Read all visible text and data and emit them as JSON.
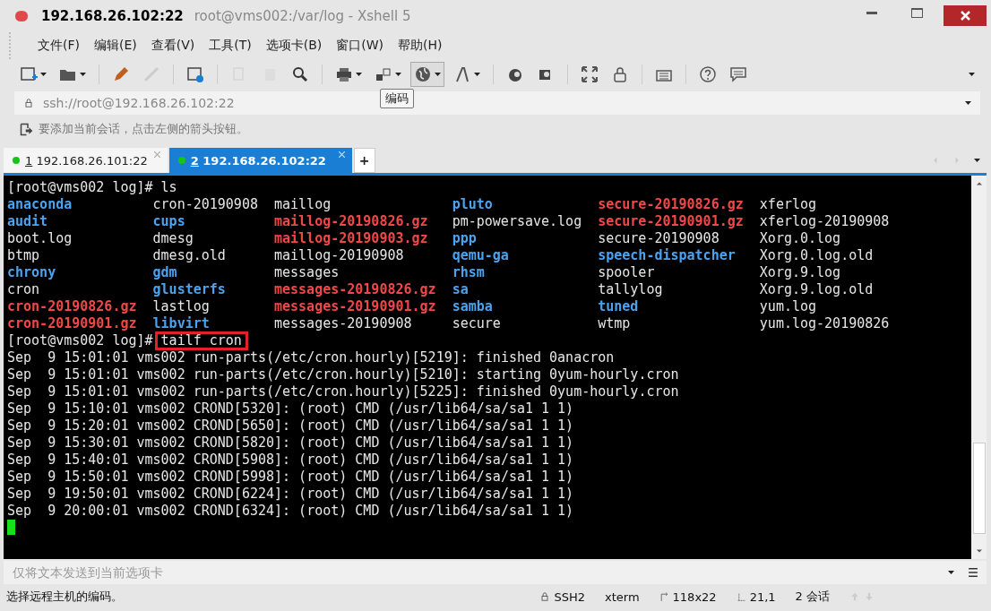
{
  "window": {
    "title": "192.168.26.102:22",
    "subtitle": "root@vms002:/var/log - Xshell 5"
  },
  "menu": [
    "文件(F)",
    "编辑(E)",
    "查看(V)",
    "工具(T)",
    "选项卡(B)",
    "窗口(W)",
    "帮助(H)"
  ],
  "tooltip": "编码",
  "address_bar": {
    "value": "ssh://root@192.168.26.102:22"
  },
  "hint_bar": "要添加当前会话，点击左侧的箭头按钮。",
  "tabs": [
    {
      "number": "1",
      "label": "192.168.26.101:22",
      "selected": false
    },
    {
      "number": "2",
      "label": "192.168.26.102:22",
      "selected": true
    }
  ],
  "new_tab": "+",
  "terminal": {
    "ls_prompt": "[root@vms002 log]# ls",
    "ls_rows": [
      [
        {
          "text": "anaconda",
          "kind": "dir"
        },
        {
          "text": "cron-20190908",
          "kind": "file"
        },
        {
          "text": "maillog",
          "kind": "file"
        },
        {
          "text": "pluto",
          "kind": "dir"
        },
        {
          "text": "secure-20190826.gz",
          "kind": "archive"
        },
        {
          "text": "xferlog",
          "kind": "file"
        }
      ],
      [
        {
          "text": "audit",
          "kind": "dir"
        },
        {
          "text": "cups",
          "kind": "dir"
        },
        {
          "text": "maillog-20190826.gz",
          "kind": "archive"
        },
        {
          "text": "pm-powersave.log",
          "kind": "file"
        },
        {
          "text": "secure-20190901.gz",
          "kind": "archive"
        },
        {
          "text": "xferlog-20190908",
          "kind": "file"
        }
      ],
      [
        {
          "text": "boot.log",
          "kind": "file"
        },
        {
          "text": "dmesg",
          "kind": "file"
        },
        {
          "text": "maillog-20190903.gz",
          "kind": "archive"
        },
        {
          "text": "ppp",
          "kind": "dir"
        },
        {
          "text": "secure-20190908",
          "kind": "file"
        },
        {
          "text": "Xorg.0.log",
          "kind": "file"
        }
      ],
      [
        {
          "text": "btmp",
          "kind": "file"
        },
        {
          "text": "dmesg.old",
          "kind": "file"
        },
        {
          "text": "maillog-20190908",
          "kind": "file"
        },
        {
          "text": "qemu-ga",
          "kind": "dir"
        },
        {
          "text": "speech-dispatcher",
          "kind": "dir"
        },
        {
          "text": "Xorg.0.log.old",
          "kind": "file"
        }
      ],
      [
        {
          "text": "chrony",
          "kind": "dir"
        },
        {
          "text": "gdm",
          "kind": "dir"
        },
        {
          "text": "messages",
          "kind": "file"
        },
        {
          "text": "rhsm",
          "kind": "dir"
        },
        {
          "text": "spooler",
          "kind": "file"
        },
        {
          "text": "Xorg.9.log",
          "kind": "file"
        }
      ],
      [
        {
          "text": "cron",
          "kind": "file"
        },
        {
          "text": "glusterfs",
          "kind": "dir"
        },
        {
          "text": "messages-20190826.gz",
          "kind": "archive"
        },
        {
          "text": "sa",
          "kind": "dir"
        },
        {
          "text": "tallylog",
          "kind": "file"
        },
        {
          "text": "Xorg.9.log.old",
          "kind": "file"
        }
      ],
      [
        {
          "text": "cron-20190826.gz",
          "kind": "archive"
        },
        {
          "text": "lastlog",
          "kind": "file"
        },
        {
          "text": "messages-20190901.gz",
          "kind": "archive"
        },
        {
          "text": "samba",
          "kind": "dir"
        },
        {
          "text": "tuned",
          "kind": "dir"
        },
        {
          "text": "yum.log",
          "kind": "file"
        }
      ],
      [
        {
          "text": "cron-20190901.gz",
          "kind": "archive"
        },
        {
          "text": "libvirt",
          "kind": "dir"
        },
        {
          "text": "messages-20190908",
          "kind": "file"
        },
        {
          "text": "secure",
          "kind": "file"
        },
        {
          "text": "wtmp",
          "kind": "file"
        },
        {
          "text": "yum.log-20190826",
          "kind": "file"
        }
      ]
    ],
    "command": {
      "prompt": "[root@vms002 log]# ",
      "text": "tailf cron",
      "highlighted": true
    },
    "output": [
      "Sep  9 15:01:01 vms002 run-parts(/etc/cron.hourly)[5219]: finished 0anacron",
      "Sep  9 15:01:01 vms002 run-parts(/etc/cron.hourly)[5210]: starting 0yum-hourly.cron",
      "Sep  9 15:01:01 vms002 run-parts(/etc/cron.hourly)[5225]: finished 0yum-hourly.cron",
      "Sep  9 15:10:01 vms002 CROND[5320]: (root) CMD (/usr/lib64/sa/sa1 1 1)",
      "Sep  9 15:20:01 vms002 CROND[5650]: (root) CMD (/usr/lib64/sa/sa1 1 1)",
      "Sep  9 15:30:01 vms002 CROND[5820]: (root) CMD (/usr/lib64/sa/sa1 1 1)",
      "Sep  9 15:40:01 vms002 CROND[5908]: (root) CMD (/usr/lib64/sa/sa1 1 1)",
      "Sep  9 15:50:01 vms002 CROND[5998]: (root) CMD (/usr/lib64/sa/sa1 1 1)",
      "Sep  9 19:50:01 vms002 CROND[6224]: (root) CMD (/usr/lib64/sa/sa1 1 1)",
      "Sep  9 20:00:01 vms002 CROND[6324]: (root) CMD (/usr/lib64/sa/sa1 1 1)"
    ]
  },
  "compose_bar": {
    "placeholder": "仅将文本发送到当前选项卡"
  },
  "status_bar": {
    "message": "选择远程主机的编码。",
    "protocol": "SSH2",
    "terminal_type": "xterm",
    "size": "118x22",
    "cursor": "21,1",
    "sessions": "2 会话"
  }
}
